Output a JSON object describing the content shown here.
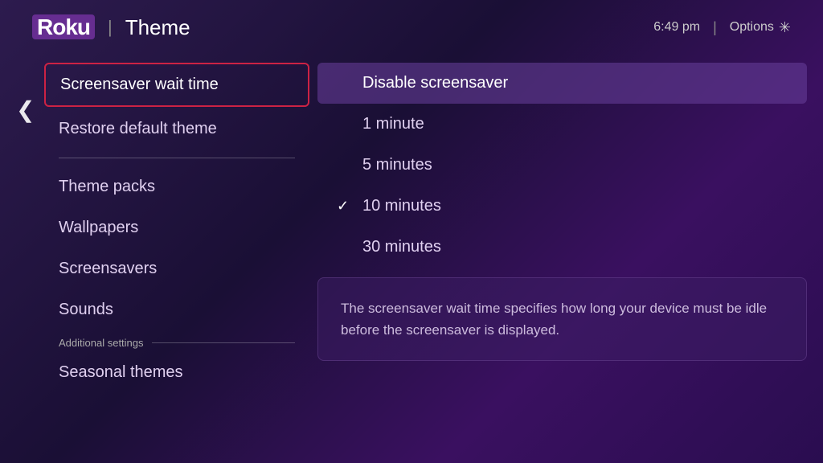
{
  "header": {
    "logo": "Roku",
    "divider": "|",
    "title": "Theme",
    "time": "6:49 pm",
    "options_label": "Options",
    "options_icon": "✳"
  },
  "sidebar": {
    "back_icon": "❮",
    "menu_items": [
      {
        "id": "screensaver-wait-time",
        "label": "Screensaver wait time",
        "active": true
      },
      {
        "id": "restore-default-theme",
        "label": "Restore default theme",
        "active": false
      }
    ],
    "section_items": [
      {
        "id": "theme-packs",
        "label": "Theme packs"
      },
      {
        "id": "wallpapers",
        "label": "Wallpapers"
      },
      {
        "id": "screensavers",
        "label": "Screensavers"
      },
      {
        "id": "sounds",
        "label": "Sounds"
      }
    ],
    "additional_label": "Additional settings",
    "additional_items": [
      {
        "id": "seasonal-themes",
        "label": "Seasonal themes"
      }
    ]
  },
  "right_panel": {
    "options": [
      {
        "id": "disable-screensaver",
        "label": "Disable screensaver",
        "selected": true,
        "checked": false
      },
      {
        "id": "1-minute",
        "label": "1 minute",
        "selected": false,
        "checked": false
      },
      {
        "id": "5-minutes",
        "label": "5 minutes",
        "selected": false,
        "checked": false
      },
      {
        "id": "10-minutes",
        "label": "10 minutes",
        "selected": false,
        "checked": true
      },
      {
        "id": "30-minutes",
        "label": "30 minutes",
        "selected": false,
        "checked": false
      }
    ],
    "description": "The screensaver wait time specifies how long your device must be idle before the screensaver is displayed."
  }
}
